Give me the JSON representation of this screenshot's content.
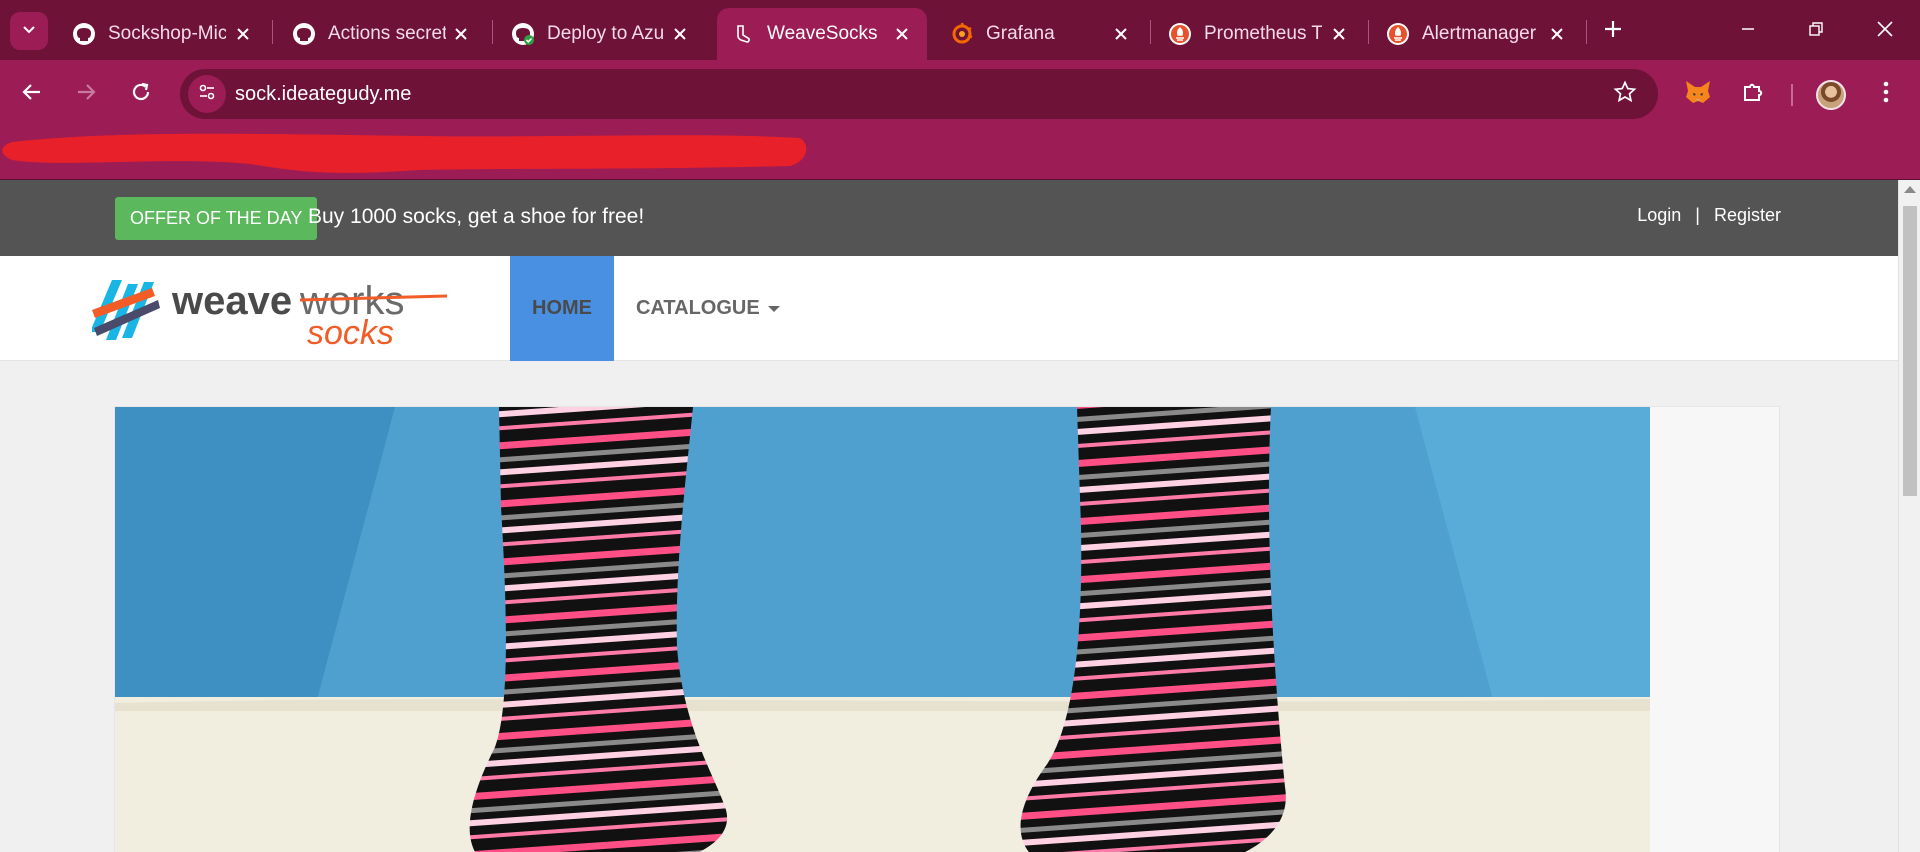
{
  "browser": {
    "tabs": [
      {
        "label": "Sockshop-Mic",
        "icon": "github-icon",
        "active": false
      },
      {
        "label": "Actions secret",
        "icon": "github-icon",
        "active": false
      },
      {
        "label": "Deploy to Azu",
        "icon": "github-check-icon",
        "active": false
      },
      {
        "label": "WeaveSocks",
        "icon": "sock-icon",
        "active": true
      },
      {
        "label": "Grafana",
        "icon": "grafana-icon",
        "active": false
      },
      {
        "label": "Prometheus Ti",
        "icon": "prometheus-icon",
        "active": false
      },
      {
        "label": "Alertmanager",
        "icon": "prometheus-icon",
        "active": false
      }
    ],
    "url": "sock.ideategudy.me",
    "colors": {
      "frame": "#6e1238",
      "toolbar": "#9c1c55",
      "redaction": "#e8202a"
    }
  },
  "page": {
    "offer": {
      "badge": "OFFER OF THE DAY",
      "text": "Buy 1000 socks, get a shoe for free!"
    },
    "auth": {
      "login": "Login",
      "separator": "|",
      "register": "Register"
    },
    "logo": {
      "word1": "weave",
      "word2": "works",
      "word3": "socks"
    },
    "nav": {
      "home": "HOME",
      "catalogue": "CATALOGUE"
    },
    "hero": {
      "image": "striped-socks-photo"
    },
    "colors": {
      "topbar": "#545454",
      "offer_badge": "#5cb85c",
      "nav_active": "#4a90e2",
      "logo_orange": "#f25c27",
      "logo_blue": "#19b5e5"
    }
  }
}
